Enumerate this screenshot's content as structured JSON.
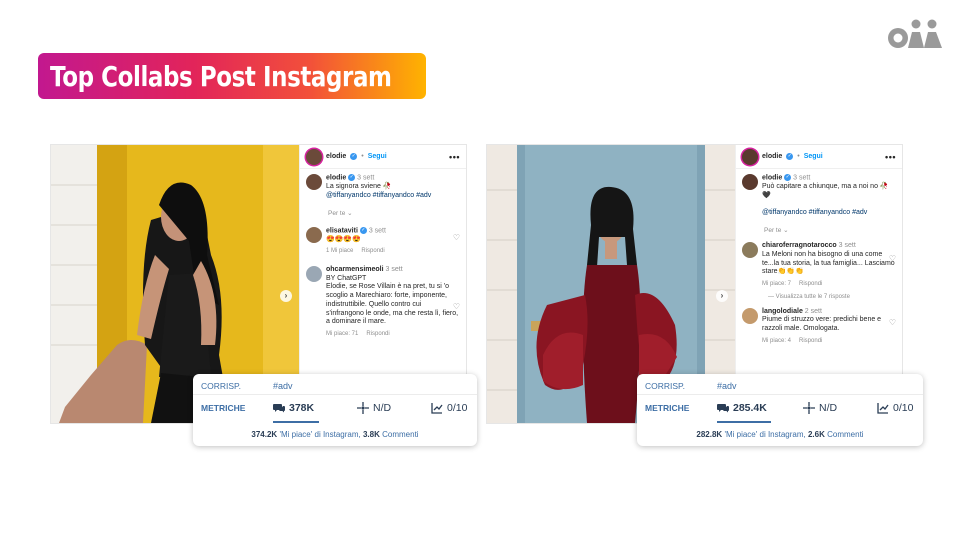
{
  "title": "Top Collabs Post Instagram",
  "brand": {
    "logo_icon": "oii-logo-icon"
  },
  "colors": {
    "accent": "#3d6ea5",
    "verified": "#3897f0",
    "follow": "#0095f6"
  },
  "posts": [
    {
      "username": "elodie",
      "follow": "Segui",
      "caption": {
        "user": "elodie",
        "time": "3 sett",
        "line1": "La signora sviene 🥀",
        "line2": "@tiffanyandco #tiffanyandco #adv"
      },
      "per_te": "Per te",
      "comments": [
        {
          "user": "elisataviti",
          "time": "3 sett",
          "text": "😍😍😍😍",
          "likes": "1 Mi piace",
          "reply": "Rispondi"
        },
        {
          "user": "ohcarmensimeoli",
          "time": "3 sett",
          "text": "BY ChatGPT\nElodie, se Rose Villain è na pret, tu si 'o scoglio a Marechiaro: forte, imponente, indistruttibile. Quello contro cui s'infrangono le onde, ma che resta lì, fiero, a dominare il mare.",
          "likes": "Mi piace: 71",
          "reply": "Rispondi"
        }
      ],
      "metrics": {
        "corrisp_label": "CORRISP.",
        "hashtag": "#adv",
        "metriche_label": "METRICHE",
        "comments": "378K",
        "reach": "N/D",
        "score": "0/10",
        "footer_likes": "374.2K",
        "footer_likes_label": "'Mi piace' di Instagram,",
        "footer_comments": "3.8K",
        "footer_comments_label": "Commenti"
      }
    },
    {
      "username": "elodie",
      "follow": "Segui",
      "caption": {
        "user": "elodie",
        "time": "3 sett",
        "line1": "Può capitare a chiunque, ma a noi no 🥀🖤",
        "line2": "@tiffanyandco #tiffanyandco #adv"
      },
      "per_te": "Per te",
      "view_replies": "Visualizza tutte le 7 risposte",
      "comments": [
        {
          "user": "chiaroferragnotarocco",
          "time": "3 sett",
          "text": "La Meloni non ha bisogno di una come te...la tua storia, la tua famiglia... Lasciamo stare👏👏👏",
          "likes": "Mi piace: 7",
          "reply": "Rispondi"
        },
        {
          "user": "langolodiale",
          "time": "2 sett",
          "text": "Piume di struzzo vere: predichi bene e razzoli male. Omologata.",
          "likes": "Mi piace: 4",
          "reply": "Rispondi"
        }
      ],
      "metrics": {
        "corrisp_label": "CORRISP.",
        "hashtag": "#adv",
        "metriche_label": "METRICHE",
        "comments": "285.4K",
        "reach": "N/D",
        "score": "0/10",
        "footer_likes": "282.8K",
        "footer_likes_label": "'Mi piace' di Instagram,",
        "footer_comments": "2.6K",
        "footer_comments_label": "Commenti"
      }
    }
  ]
}
